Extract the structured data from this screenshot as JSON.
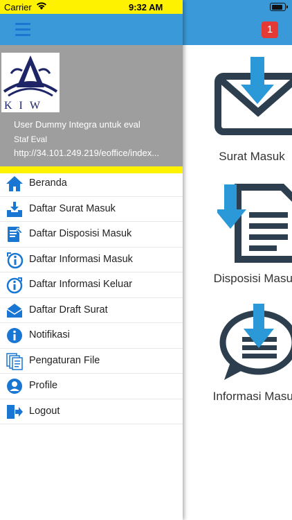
{
  "status_bar": {
    "carrier": "Carrier",
    "time": "9:32 AM"
  },
  "header": {
    "notification_count": "1"
  },
  "profile": {
    "logo_text": "KIW",
    "name": "User Dummy Integra untuk eval",
    "role": "Staf Eval",
    "url": "http://34.101.249.219/eoffice/index..."
  },
  "menu": {
    "items": [
      {
        "label": "Beranda",
        "icon": "home-icon"
      },
      {
        "label": "Daftar Surat Masuk",
        "icon": "inbox-download-icon"
      },
      {
        "label": "Daftar Disposisi Masuk",
        "icon": "document-edit-icon"
      },
      {
        "label": "Daftar Informasi Masuk",
        "icon": "info-in-icon"
      },
      {
        "label": "Daftar Informasi Keluar",
        "icon": "info-out-icon"
      },
      {
        "label": "Daftar Draft Surat",
        "icon": "envelope-open-icon"
      },
      {
        "label": "Notifikasi",
        "icon": "info-icon"
      },
      {
        "label": "Pengaturan File",
        "icon": "files-icon"
      },
      {
        "label": "Profile",
        "icon": "user-circle-icon"
      },
      {
        "label": "Logout",
        "icon": "logout-icon"
      }
    ]
  },
  "dashboard": {
    "tiles": [
      {
        "label": "Surat Masuk",
        "icon": "mail-download-icon"
      },
      {
        "label": "Disposisi Masuk",
        "icon": "document-download-icon"
      },
      {
        "label": "Informasi Masuk",
        "icon": "chat-download-icon"
      }
    ]
  },
  "colors": {
    "header_blue": "#3a9ad9",
    "icon_blue": "#1976d2",
    "status_yellow": "#fff200",
    "badge_red": "#e53935",
    "profile_grey": "#9e9e9e",
    "tile_dark": "#2d3e4e"
  }
}
